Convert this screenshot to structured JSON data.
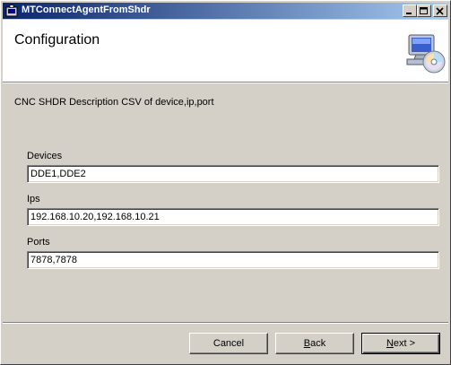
{
  "window": {
    "title": "MTConnectAgentFromShdr",
    "header_title": "Configuration",
    "header_icon": "computer-cd-icon"
  },
  "description": "CNC SHDR Description CSV of device,ip,port",
  "fields": {
    "devices": {
      "label": "Devices",
      "value": "DDE1,DDE2"
    },
    "ips": {
      "label": "Ips",
      "value": "192.168.10.20,192.168.10.21"
    },
    "ports": {
      "label": "Ports",
      "value": "7878,7878"
    }
  },
  "buttons": {
    "cancel": "Cancel",
    "back_mnemonic": "B",
    "back_rest": "ack",
    "next_mnemonic": "N",
    "next_rest": "ext >"
  },
  "colors": {
    "titlebar_start": "#0a246a",
    "titlebar_end": "#a6caf0",
    "face": "#d4d0c8"
  }
}
